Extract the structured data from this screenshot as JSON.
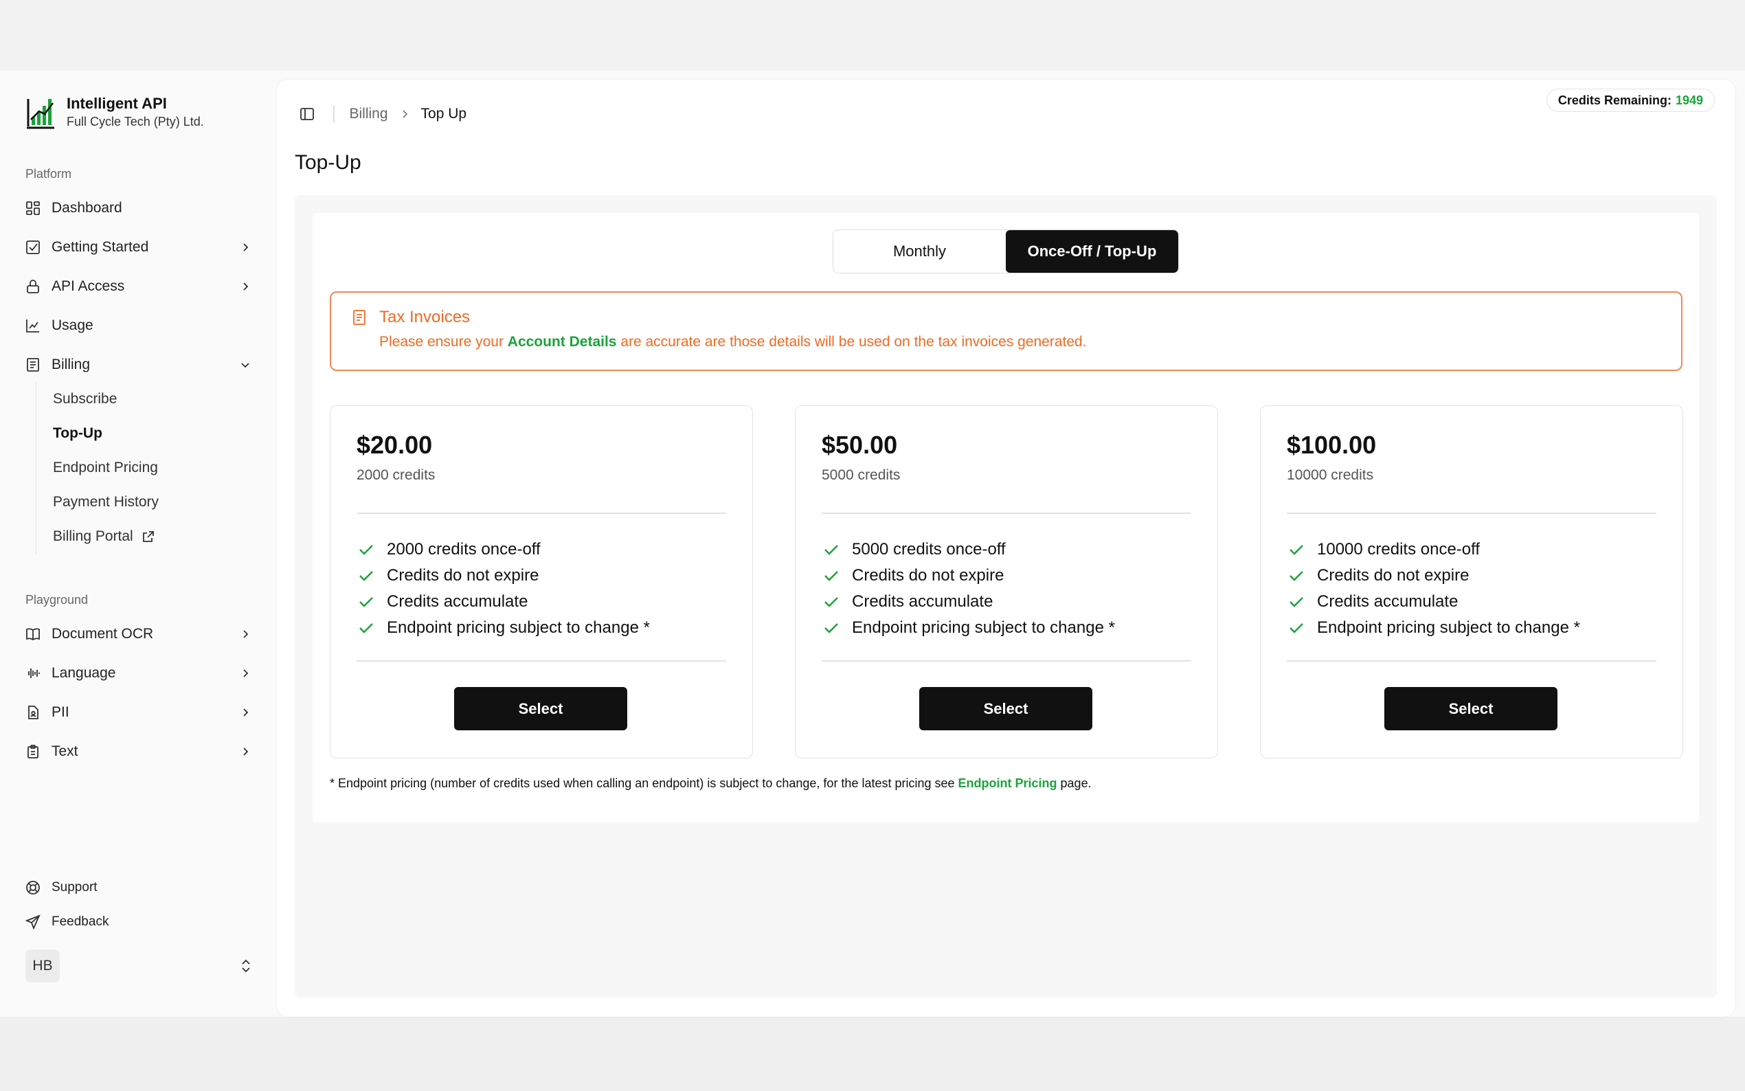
{
  "brand": {
    "name": "Intelligent API",
    "org": "Full Cycle Tech (Pty) Ltd."
  },
  "sidebar": {
    "platform_label": "Platform",
    "items": [
      {
        "label": "Dashboard",
        "icon": "dashboard-icon"
      },
      {
        "label": "Getting Started",
        "icon": "checklist-icon"
      },
      {
        "label": "API Access",
        "icon": "lock-icon"
      },
      {
        "label": "Usage",
        "icon": "chart-icon"
      },
      {
        "label": "Billing",
        "icon": "receipt-icon"
      }
    ],
    "billing_sub": [
      {
        "label": "Subscribe"
      },
      {
        "label": "Top-Up"
      },
      {
        "label": "Endpoint Pricing"
      },
      {
        "label": "Payment History"
      },
      {
        "label": "Billing Portal"
      }
    ],
    "playground_label": "Playground",
    "playground_items": [
      {
        "label": "Document OCR",
        "icon": "book-icon"
      },
      {
        "label": "Language",
        "icon": "audio-wave-icon"
      },
      {
        "label": "PII",
        "icon": "document-user-icon"
      },
      {
        "label": "Text",
        "icon": "clipboard-icon"
      }
    ],
    "support_label": "Support",
    "feedback_label": "Feedback",
    "user_initials": "HB"
  },
  "header": {
    "breadcrumb_parent": "Billing",
    "breadcrumb_current": "Top Up",
    "credits_label": "Credits Remaining:",
    "credits_value": "1949"
  },
  "page": {
    "title": "Top-Up"
  },
  "toggle": {
    "monthly": "Monthly",
    "once_off": "Once-Off / Top-Up",
    "active": "once_off"
  },
  "alert": {
    "title": "Tax Invoices",
    "text_before": "Please ensure your ",
    "link_text": "Account Details",
    "text_after": " are accurate are those details will be used on the tax invoices generated."
  },
  "plans": [
    {
      "price": "$20.00",
      "credits": "2000 credits",
      "features": [
        "2000 credits once-off",
        "Credits do not expire",
        "Credits accumulate",
        "Endpoint pricing subject to change *"
      ],
      "button": "Select"
    },
    {
      "price": "$50.00",
      "credits": "5000 credits",
      "features": [
        "5000 credits once-off",
        "Credits do not expire",
        "Credits accumulate",
        "Endpoint pricing subject to change *"
      ],
      "button": "Select"
    },
    {
      "price": "$100.00",
      "credits": "10000 credits",
      "features": [
        "10000 credits once-off",
        "Credits do not expire",
        "Credits accumulate",
        "Endpoint pricing subject to change *"
      ],
      "button": "Select"
    }
  ],
  "footnote": {
    "text_before": "* Endpoint pricing (number of credits used when calling an endpoint) is subject to change, for the latest pricing see ",
    "link_text": "Endpoint Pricing",
    "text_after": " page."
  },
  "colors": {
    "accent_green": "#1aa33a",
    "alert_orange": "#ef6a22",
    "primary_black": "#111111"
  }
}
